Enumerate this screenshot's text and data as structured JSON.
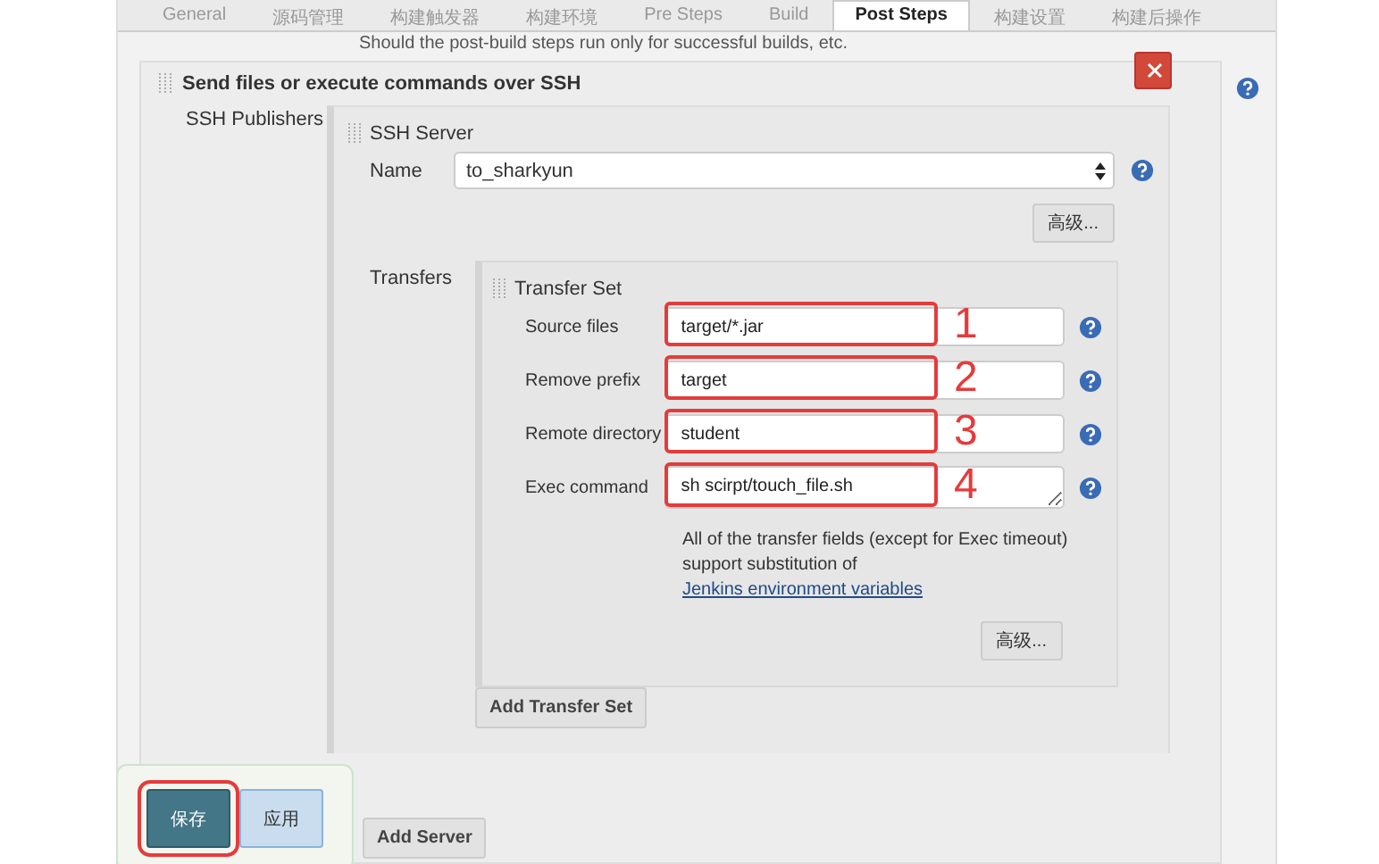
{
  "tabs": [
    {
      "label": "General",
      "selected": false
    },
    {
      "label": "源码管理",
      "selected": false
    },
    {
      "label": "构建触发器",
      "selected": false
    },
    {
      "label": "构建环境",
      "selected": false
    },
    {
      "label": "Pre Steps",
      "selected": false
    },
    {
      "label": "Build",
      "selected": false
    },
    {
      "label": "Post Steps",
      "selected": true
    },
    {
      "label": "构建设置",
      "selected": false
    },
    {
      "label": "构建后操作",
      "selected": false
    }
  ],
  "hint": "Should the post-build steps run only for successful builds, etc.",
  "section": {
    "title": "Send files or execute commands over SSH",
    "label": "SSH Publishers",
    "server": {
      "title": "SSH Server",
      "name_label": "Name",
      "name_value": "to_sharkyun",
      "advanced_button": "高级...",
      "transfers_label": "Transfers",
      "transfer_set": {
        "title": "Transfer Set",
        "fields": [
          {
            "label": "Source files",
            "value": "target/*.jar",
            "kind": "input",
            "annotation": "1"
          },
          {
            "label": "Remove prefix",
            "value": "target",
            "kind": "input",
            "annotation": "2"
          },
          {
            "label": "Remote directory",
            "value": "student",
            "kind": "input",
            "annotation": "3"
          },
          {
            "label": "Exec command",
            "value": "sh scirpt/touch_file.sh",
            "kind": "textarea",
            "annotation": "4"
          }
        ],
        "note": "All of the transfer fields (except for Exec timeout) support substitution of",
        "note_link": "Jenkins environment variables",
        "advanced_button": "高级..."
      },
      "add_transfer_button": "Add Transfer Set"
    },
    "add_server_button": "Add Server"
  },
  "footer_buttons": [
    {
      "label": "保存",
      "kind": "primary",
      "annotated": true
    },
    {
      "label": "应用",
      "kind": "secondary",
      "annotated": false
    }
  ]
}
